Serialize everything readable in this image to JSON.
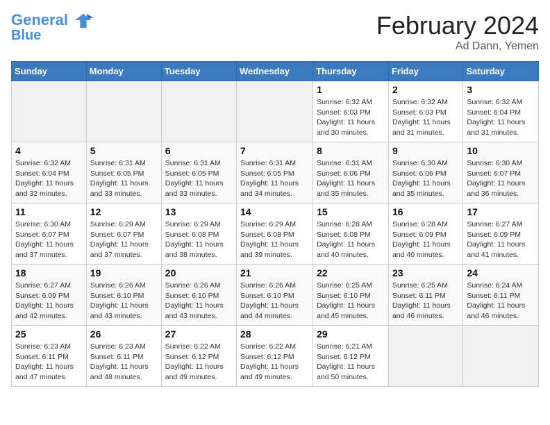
{
  "header": {
    "logo_line1": "General",
    "logo_line2": "Blue",
    "month_title": "February 2024",
    "location": "Ad Dann, Yemen"
  },
  "days_of_week": [
    "Sunday",
    "Monday",
    "Tuesday",
    "Wednesday",
    "Thursday",
    "Friday",
    "Saturday"
  ],
  "weeks": [
    [
      {
        "day": "",
        "info": ""
      },
      {
        "day": "",
        "info": ""
      },
      {
        "day": "",
        "info": ""
      },
      {
        "day": "",
        "info": ""
      },
      {
        "day": "1",
        "info": "Sunrise: 6:32 AM\nSunset: 6:03 PM\nDaylight: 11 hours and 30 minutes."
      },
      {
        "day": "2",
        "info": "Sunrise: 6:32 AM\nSunset: 6:03 PM\nDaylight: 11 hours and 31 minutes."
      },
      {
        "day": "3",
        "info": "Sunrise: 6:32 AM\nSunset: 6:04 PM\nDaylight: 11 hours and 31 minutes."
      }
    ],
    [
      {
        "day": "4",
        "info": "Sunrise: 6:32 AM\nSunset: 6:04 PM\nDaylight: 11 hours and 32 minutes."
      },
      {
        "day": "5",
        "info": "Sunrise: 6:31 AM\nSunset: 6:05 PM\nDaylight: 11 hours and 33 minutes."
      },
      {
        "day": "6",
        "info": "Sunrise: 6:31 AM\nSunset: 6:05 PM\nDaylight: 11 hours and 33 minutes."
      },
      {
        "day": "7",
        "info": "Sunrise: 6:31 AM\nSunset: 6:05 PM\nDaylight: 11 hours and 34 minutes."
      },
      {
        "day": "8",
        "info": "Sunrise: 6:31 AM\nSunset: 6:06 PM\nDaylight: 11 hours and 35 minutes."
      },
      {
        "day": "9",
        "info": "Sunrise: 6:30 AM\nSunset: 6:06 PM\nDaylight: 11 hours and 35 minutes."
      },
      {
        "day": "10",
        "info": "Sunrise: 6:30 AM\nSunset: 6:07 PM\nDaylight: 11 hours and 36 minutes."
      }
    ],
    [
      {
        "day": "11",
        "info": "Sunrise: 6:30 AM\nSunset: 6:07 PM\nDaylight: 11 hours and 37 minutes."
      },
      {
        "day": "12",
        "info": "Sunrise: 6:29 AM\nSunset: 6:07 PM\nDaylight: 11 hours and 37 minutes."
      },
      {
        "day": "13",
        "info": "Sunrise: 6:29 AM\nSunset: 6:08 PM\nDaylight: 11 hours and 38 minutes."
      },
      {
        "day": "14",
        "info": "Sunrise: 6:29 AM\nSunset: 6:08 PM\nDaylight: 11 hours and 39 minutes."
      },
      {
        "day": "15",
        "info": "Sunrise: 6:28 AM\nSunset: 6:08 PM\nDaylight: 11 hours and 40 minutes."
      },
      {
        "day": "16",
        "info": "Sunrise: 6:28 AM\nSunset: 6:09 PM\nDaylight: 11 hours and 40 minutes."
      },
      {
        "day": "17",
        "info": "Sunrise: 6:27 AM\nSunset: 6:09 PM\nDaylight: 11 hours and 41 minutes."
      }
    ],
    [
      {
        "day": "18",
        "info": "Sunrise: 6:27 AM\nSunset: 6:09 PM\nDaylight: 11 hours and 42 minutes."
      },
      {
        "day": "19",
        "info": "Sunrise: 6:26 AM\nSunset: 6:10 PM\nDaylight: 11 hours and 43 minutes."
      },
      {
        "day": "20",
        "info": "Sunrise: 6:26 AM\nSunset: 6:10 PM\nDaylight: 11 hours and 43 minutes."
      },
      {
        "day": "21",
        "info": "Sunrise: 6:26 AM\nSunset: 6:10 PM\nDaylight: 11 hours and 44 minutes."
      },
      {
        "day": "22",
        "info": "Sunrise: 6:25 AM\nSunset: 6:10 PM\nDaylight: 11 hours and 45 minutes."
      },
      {
        "day": "23",
        "info": "Sunrise: 6:25 AM\nSunset: 6:11 PM\nDaylight: 11 hours and 46 minutes."
      },
      {
        "day": "24",
        "info": "Sunrise: 6:24 AM\nSunset: 6:11 PM\nDaylight: 11 hours and 46 minutes."
      }
    ],
    [
      {
        "day": "25",
        "info": "Sunrise: 6:23 AM\nSunset: 6:11 PM\nDaylight: 11 hours and 47 minutes."
      },
      {
        "day": "26",
        "info": "Sunrise: 6:23 AM\nSunset: 6:11 PM\nDaylight: 11 hours and 48 minutes."
      },
      {
        "day": "27",
        "info": "Sunrise: 6:22 AM\nSunset: 6:12 PM\nDaylight: 11 hours and 49 minutes."
      },
      {
        "day": "28",
        "info": "Sunrise: 6:22 AM\nSunset: 6:12 PM\nDaylight: 11 hours and 49 minutes."
      },
      {
        "day": "29",
        "info": "Sunrise: 6:21 AM\nSunset: 6:12 PM\nDaylight: 11 hours and 50 minutes."
      },
      {
        "day": "",
        "info": ""
      },
      {
        "day": "",
        "info": ""
      }
    ]
  ]
}
